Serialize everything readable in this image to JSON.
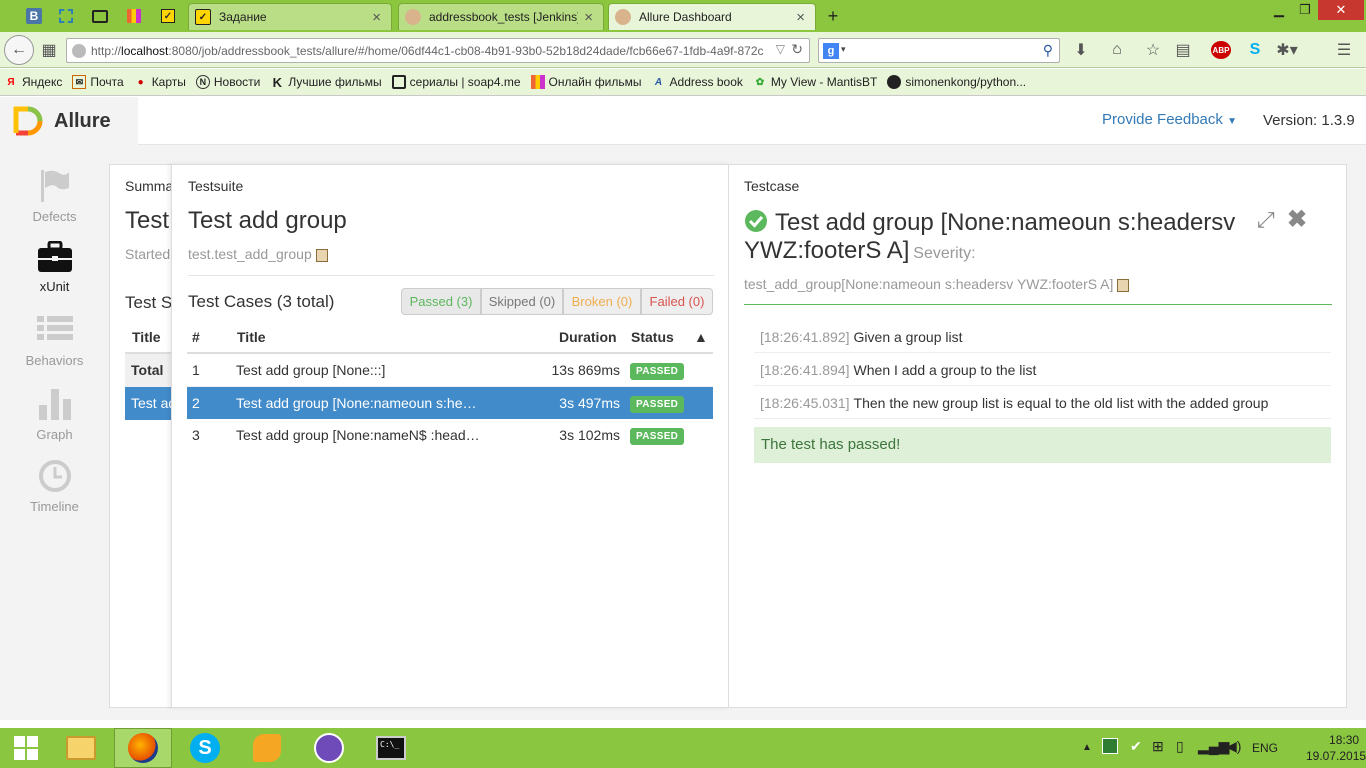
{
  "browser": {
    "tabs": [
      {
        "label": "Задание",
        "active": false
      },
      {
        "label": "addressbook_tests [Jenkins]",
        "active": false
      },
      {
        "label": "Allure Dashboard",
        "active": true
      }
    ],
    "url_prefix": "http://",
    "url_host": "localhost",
    "url_rest": ":8080/job/addressbook_tests/allure/#/home/06df44c1-cb08-4b91-93b0-52b18d24dade/fcb66e67-1fdb-4a9f-872c",
    "bookmarks": [
      "Яндекс",
      "Почта",
      "Карты",
      "Новости",
      "Лучшие фильмы",
      "сериалы | soap4.me",
      "Онлайн фильмы",
      "Address book",
      "My View - MantisBT",
      "simonenkong/python..."
    ]
  },
  "allure": {
    "brand": "Allure",
    "feedback": "Provide Feedback",
    "version": "Version: 1.3.9",
    "sidebar": [
      {
        "label": "Defects",
        "icon": "flag-icon"
      },
      {
        "label": "xUnit",
        "icon": "briefcase-icon"
      },
      {
        "label": "Behaviors",
        "icon": "list-icon"
      },
      {
        "label": "Graph",
        "icon": "bar-chart-icon"
      },
      {
        "label": "Timeline",
        "icon": "clock-icon"
      }
    ],
    "summary": {
      "title": "Summa",
      "heading": "Test",
      "started": "Started",
      "section": "Test S",
      "col_title": "Title",
      "total": "Total",
      "row": "Test ad"
    },
    "testsuite": {
      "label": "Testsuite",
      "name": "Test add group",
      "id": "test.test_add_group",
      "cases_title": "Test Cases (3 total)",
      "filters": {
        "passed": "Passed (3)",
        "skipped": "Skipped (0)",
        "broken": "Broken (0)",
        "failed": "Failed (0)"
      },
      "columns": {
        "num": "#",
        "title": "Title",
        "duration": "Duration",
        "status": "Status",
        "sort": "▲"
      },
      "rows": [
        {
          "num": "1",
          "title": "Test add group [None:::]",
          "duration": "13s 869ms",
          "status": "PASSED"
        },
        {
          "num": "2",
          "title": "Test add group [None:nameoun s:he…",
          "duration": "3s 497ms",
          "status": "PASSED"
        },
        {
          "num": "3",
          "title": "Test add group [None:nameN$ :head…",
          "duration": "3s 102ms",
          "status": "PASSED"
        }
      ]
    },
    "testcase": {
      "label": "Testcase",
      "title_line1": "Test add group [None:nameoun s:headersv",
      "title_line2": "YWZ:footerS A]",
      "severity": "Severity:",
      "id": "test_add_group[None:nameoun s:headersv YWZ:footerS A]",
      "steps": [
        {
          "time": "[18:26:41.892]",
          "text": "Given a group list"
        },
        {
          "time": "[18:26:41.894]",
          "text": "When I add a group to the list"
        },
        {
          "time": "[18:26:45.031]",
          "text": "Then the new group list is equal to the old list with the added group"
        }
      ],
      "result": "The test has passed!"
    }
  },
  "taskbar": {
    "lang": "ENG",
    "time": "18:30",
    "date": "19.07.2015"
  },
  "colors": {
    "accent": "#337ab7",
    "passed": "#5cb85c",
    "selected": "#428bca",
    "broken": "#f0ad4e",
    "failed": "#d9534f",
    "chrome": "#8cc63f"
  }
}
